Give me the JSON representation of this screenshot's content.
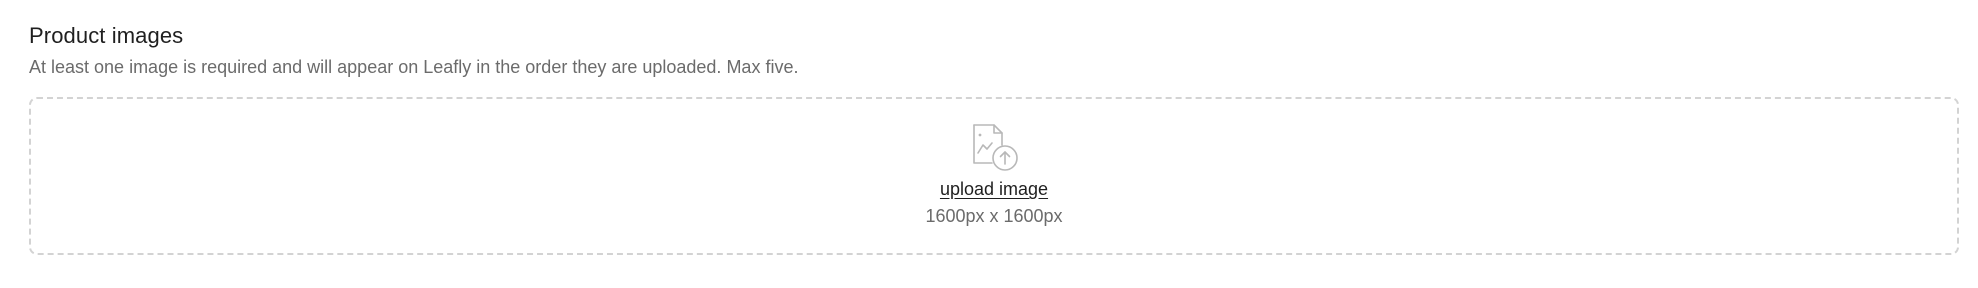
{
  "section": {
    "title": "Product images",
    "description": "At least one image is required and will appear on Leafly in the order they are uploaded. Max five."
  },
  "dropzone": {
    "icon": "image-upload-icon",
    "upload_label": "upload image",
    "dimensions": "1600px x 1600px"
  },
  "colors": {
    "text_primary": "#1f1f1f",
    "text_secondary": "#6b6b6b",
    "border_dashed": "#d3d3d3",
    "icon_gray": "#b8b8b8"
  }
}
